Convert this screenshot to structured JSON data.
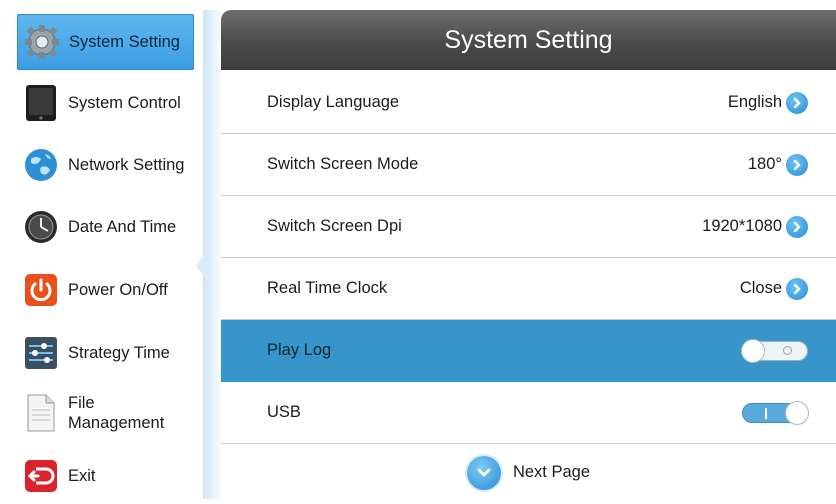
{
  "sidebar": {
    "items": [
      {
        "label": "System Setting",
        "icon": "gear-icon"
      },
      {
        "label": "System Control",
        "icon": "tablet-icon"
      },
      {
        "label": "Network Setting",
        "icon": "globe-icon"
      },
      {
        "label": "Date And Time",
        "icon": "clock-icon"
      },
      {
        "label": "Power On/Off",
        "icon": "power-icon"
      },
      {
        "label": "Strategy Time",
        "icon": "sliders-icon"
      },
      {
        "label": "File Management",
        "icon": "document-icon"
      },
      {
        "label": "Exit",
        "icon": "exit-icon"
      }
    ],
    "active_index": 0
  },
  "header": {
    "title": "System Setting"
  },
  "settings": [
    {
      "label": "Display Language",
      "value": "English"
    },
    {
      "label": "Switch Screen Mode",
      "value": "180°"
    },
    {
      "label": "Switch Screen Dpi",
      "value": "1920*1080"
    },
    {
      "label": "Real Time Clock",
      "value": "Close"
    },
    {
      "label": "Play Log",
      "toggle": "off"
    },
    {
      "label": "USB",
      "toggle": "on"
    }
  ],
  "footer": {
    "next_label": "Next Page"
  },
  "colors": {
    "accent": "#3795c9",
    "active_sidebar": "#4aa8e8",
    "header": "#555555"
  }
}
